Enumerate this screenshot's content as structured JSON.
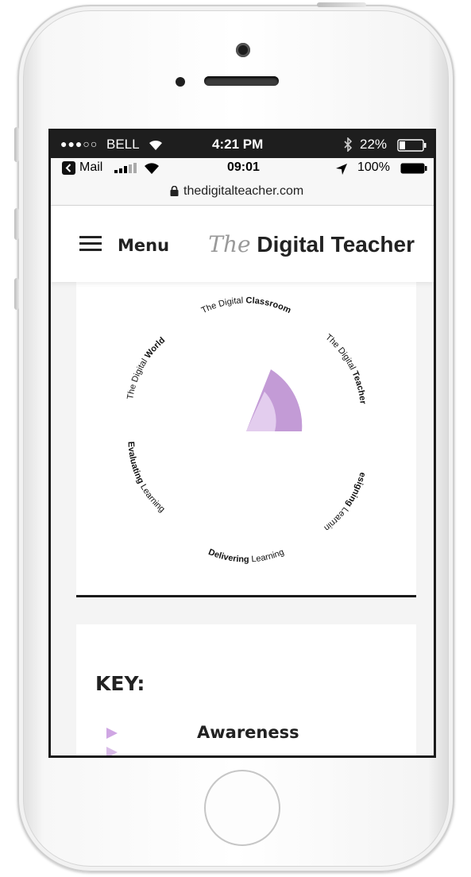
{
  "status_bar_outer": {
    "signal": "●●●○○",
    "carrier": "BELL",
    "time": "4:21 PM",
    "battery_pct": "22%"
  },
  "status_bar_inner": {
    "back_app": "Mail",
    "time": "09:01",
    "battery_pct": "100%"
  },
  "address_bar": {
    "url": "thedigitalteacher.com"
  },
  "site_header": {
    "menu_label": "Menu",
    "brand_prefix": "The",
    "brand_name": "Digital Teacher"
  },
  "wheel": {
    "segments": [
      {
        "prefix": "The Digital",
        "emphasis": "Classroom"
      },
      {
        "prefix": "The Digital",
        "emphasis": "Teacher"
      },
      {
        "prefix": "Learning",
        "emphasis": "Designing"
      },
      {
        "prefix": "Learning",
        "emphasis": "Delivering"
      },
      {
        "prefix": "Learning",
        "emphasis": "Evaluating"
      },
      {
        "prefix": "The Digital",
        "emphasis": "World"
      }
    ],
    "colors": {
      "strong": "#c39bd6",
      "light": "#e3cdee"
    }
  },
  "key": {
    "title": "KEY:",
    "items": [
      {
        "label": "Awareness",
        "color": "#cfa6e3"
      }
    ]
  }
}
